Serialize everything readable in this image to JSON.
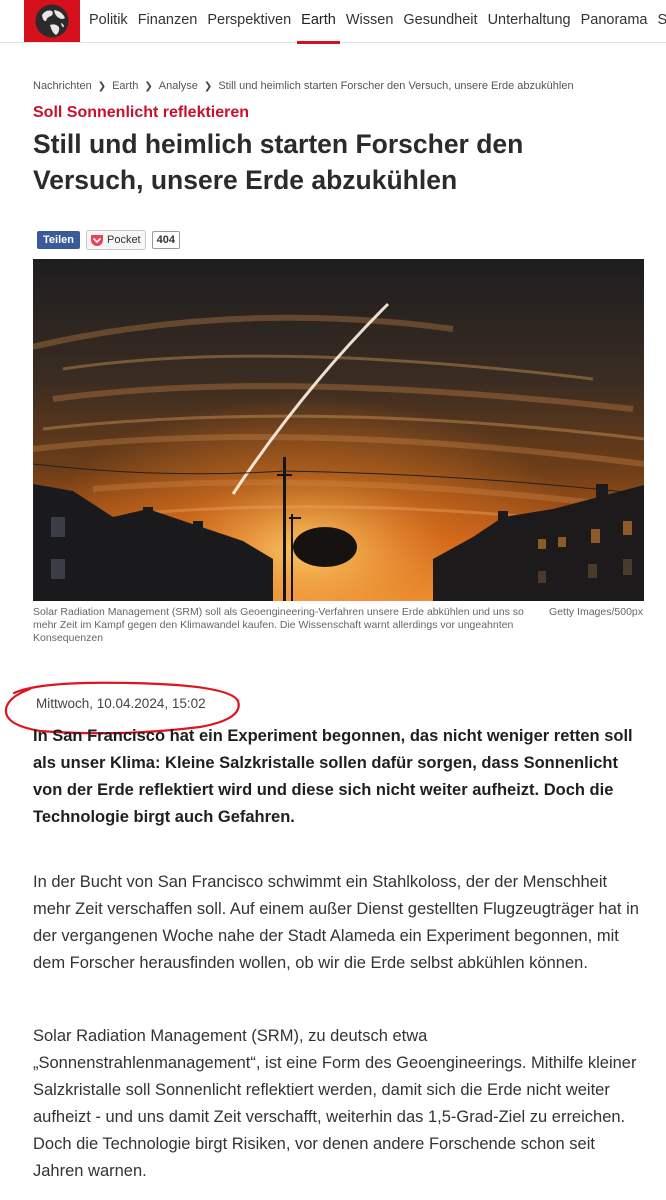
{
  "nav": {
    "items": [
      "Politik",
      "Finanzen",
      "Perspektiven",
      "Earth",
      "Wissen",
      "Gesundheit",
      "Unterhaltung",
      "Panorama",
      "Sp"
    ],
    "active": "Earth"
  },
  "breadcrumb": [
    "Nachrichten",
    "Earth",
    "Analyse",
    "Still und heimlich starten Forscher den Versuch, unsere Erde abzukühlen"
  ],
  "article": {
    "kicker": "Soll Sonnenlicht reflektieren",
    "headline": "Still und heimlich starten Forscher den Versuch, unsere Erde abzukühlen",
    "share_label": "Teilen",
    "pocket_label": "Pocket",
    "share_count": "404",
    "caption": "Solar Radiation Management (SRM) soll als Geoengineering-Verfahren unsere Erde abkühlen und uns so mehr Zeit im Kampf gegen den Klimawandel kaufen. Die Wissenschaft warnt allerdings vor ungeahnten Konsequenzen",
    "credit": "Getty Images/500px",
    "date": "Mittwoch, 10.04.2024, 15:02",
    "lead": "In San Francisco hat ein Experiment begonnen, das nicht weniger retten soll als unser Klima: Kleine Salzkristalle sollen dafür sorgen, dass Sonnenlicht von der Erde reflektiert wird und diese sich nicht weiter aufheizt. Doch die Technologie birgt auch Gefahren.",
    "paragraphs": [
      "In der Bucht von San Francisco schwimmt ein Stahlkoloss, der der Menschheit mehr Zeit verschaffen soll. Auf einem außer Dienst gestellten Flugzeugträger hat in der vergangenen Woche nahe der Stadt Alameda ein Experiment begonnen, mit dem Forscher herausfinden wollen, ob wir die Erde selbst abkühlen können.",
      "Solar Radiation Management (SRM), zu deutsch etwa „Sonnenstrahlenmanagement“, ist eine Form des Geoengineerings. Mithilfe kleiner Salzkristalle soll Sonnenlicht reflektiert werden, damit sich die Erde nicht weiter aufheizt - und uns damit Zeit verschafft, weiterhin das 1,5-Grad-Ziel zu erreichen. Doch die Technologie birgt Risiken, vor denen andere Forschende schon seit Jahren warnen."
    ]
  },
  "colors": {
    "brand_red": "#d6101d",
    "kicker_red": "#c8102e",
    "share_blue": "#3b5a9a",
    "annotation_red": "#e0141e"
  },
  "icons": [
    "globe-logo-icon",
    "chevron-right-icon",
    "pocket-icon"
  ]
}
